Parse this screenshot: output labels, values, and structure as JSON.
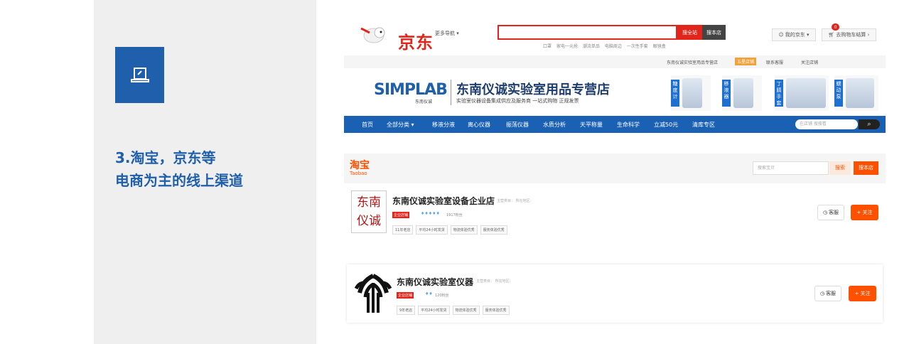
{
  "slide": {
    "title_line1": "3.淘宝，京东等",
    "title_line2": "电商为主的线上渠道"
  },
  "jd": {
    "logo_text": "京东",
    "more_label": "更多导航 ▾",
    "search_all_label": "搜全站",
    "search_shop_label": "搜本店",
    "hotwords": [
      "口罩",
      "家电一元抢",
      "潮流单品",
      "电脑周边",
      "一次性手套",
      "眼镜盒"
    ],
    "my_jd_label": "我的京东 ▾",
    "cart_label": "去购物车结算 ›",
    "cart_count": "0",
    "shopbar": {
      "shop_name": "东南仪诚实验室用品专营店",
      "badge": "五星店铺",
      "contact": "联系客服",
      "follow": "关注店铺"
    },
    "banner": {
      "brand": "SIMPLAB",
      "brand_sub": "东南仪诚",
      "store_title": "东南仪诚实验室用品专营店",
      "slogan": "实验室仪器设备集成供应及服务商 一站式购物 正规发票",
      "products": [
        "糖度计",
        "移液器",
        "丁腈手套",
        "蠕动泵"
      ]
    },
    "nav": {
      "items": [
        "首页",
        "全部分类 ▾",
        "移液分液",
        "离心仪器",
        "振荡仪器",
        "水质分析",
        "天平称量",
        "生命科学",
        "立减50元",
        "清库专区"
      ],
      "search_placeholder": "在店铺  搜搜看"
    }
  },
  "taobao": {
    "logo": "淘宝",
    "logo_en": "Taobao",
    "search_placeholder": "搜索宝贝",
    "search_all_label": "搜索",
    "search_shop_label": "搜本店",
    "shops": [
      {
        "avatar_text": "东南仪诚",
        "name": "东南仪诚实验室设备企业店",
        "meta": "主营类目：   所在地区：",
        "enterprise": "企业店铺",
        "diamonds": "♦♦♦♦♦",
        "fans": "1917粉丝",
        "tags": [
          "11年老店",
          "平均24小时发货",
          "物流体验优秀",
          "服务体验优秀"
        ],
        "service_label": "客服",
        "follow_label": "+ 关注"
      },
      {
        "name": "东南仪诚实验室仪器",
        "meta": "主营类目：   所在地区：",
        "enterprise": "企业店铺",
        "diamonds": "♦♦",
        "fans": "120粉丝",
        "tags": [
          "9年老店",
          "平均24小时发货",
          "物流体验优秀",
          "服务体验优秀"
        ],
        "service_label": "客服",
        "follow_label": "+ 关注"
      }
    ]
  },
  "colors": {
    "slide_blue": "#1f5fab",
    "jd_red": "#e1251b",
    "taobao_orange": "#ff5000",
    "nav_blue": "#1a61b4"
  },
  "icons": [
    "laptop-icon",
    "jd-dog-mascot",
    "user-icon",
    "cart-icon",
    "search-icon",
    "service-icon"
  ]
}
